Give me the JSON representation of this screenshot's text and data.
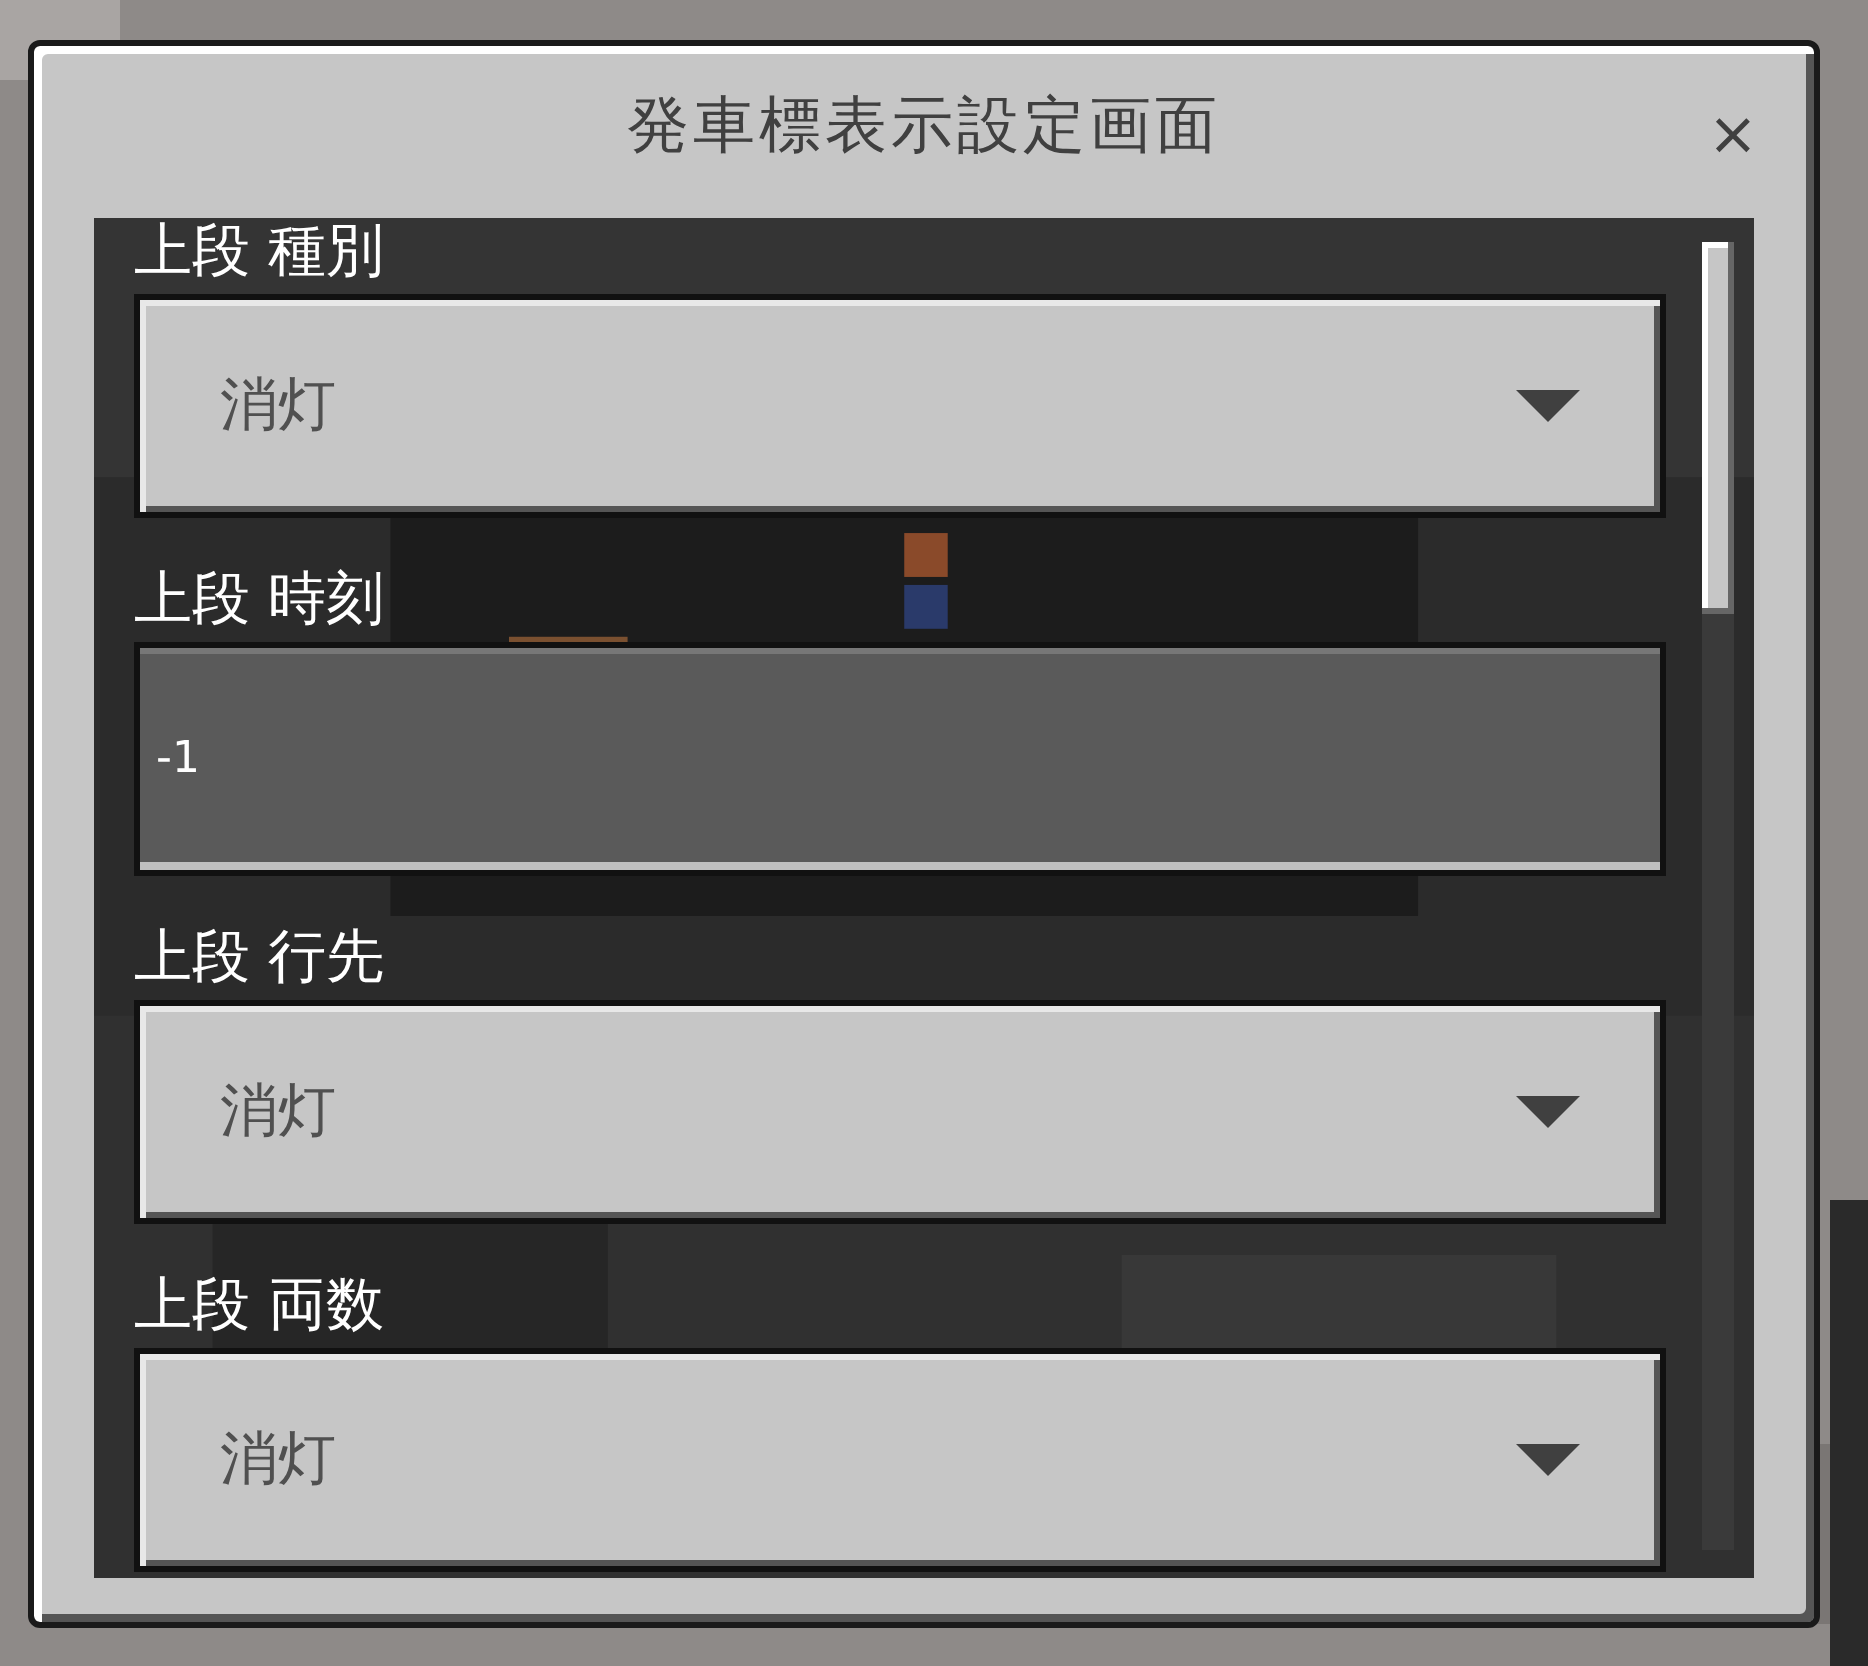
{
  "window": {
    "title": "発車標表示設定画面",
    "close": "×"
  },
  "fields": [
    {
      "label": "上段 種別",
      "kind": "dropdown",
      "value": "消灯"
    },
    {
      "label": "上段 時刻",
      "kind": "text",
      "value": "-1"
    },
    {
      "label": "上段 行先",
      "kind": "dropdown",
      "value": "消灯"
    },
    {
      "label": "上段 両数",
      "kind": "dropdown",
      "value": "消灯"
    }
  ]
}
